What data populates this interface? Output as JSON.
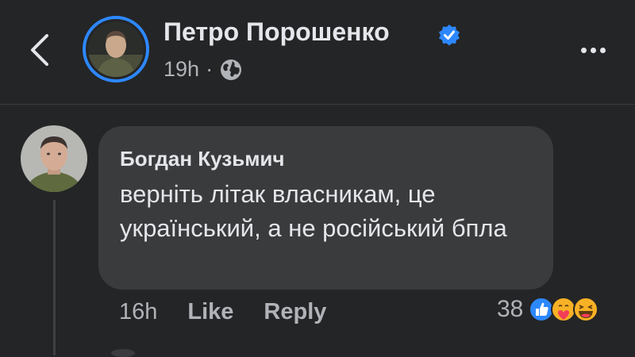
{
  "header": {
    "page_name": "Петро Порошенко",
    "post_time": "19h",
    "separator": "·",
    "audience_icon": "globe-icon",
    "back_icon": "chevron-left-icon",
    "more_icon": "more-dots-icon",
    "verified_icon": "verified-badge-icon"
  },
  "comment": {
    "author": "Богдан Кузьмич",
    "text": "верніть літак власникам, це український, а не російський бпла",
    "time": "16h",
    "like_label": "Like",
    "reply_label": "Reply",
    "reaction_count": "38",
    "reactions": [
      "like-reaction-icon",
      "care-reaction-icon",
      "haha-reaction-icon"
    ]
  },
  "colors": {
    "background": "#242526",
    "bubble": "#3a3b3c",
    "text": "#e4e6eb",
    "secondary_text": "#b0b3b8",
    "accent": "#2d88ff"
  }
}
